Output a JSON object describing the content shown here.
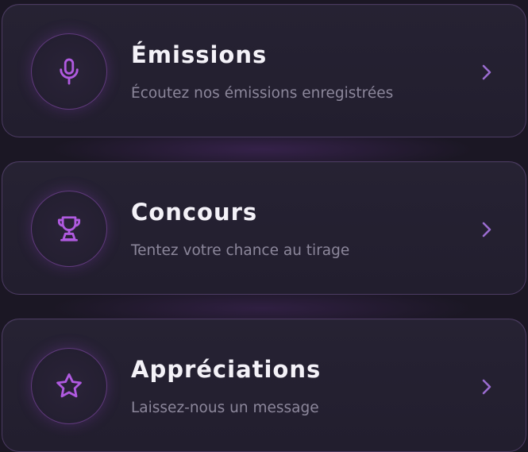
{
  "colors": {
    "accent": "#a855d8",
    "chevron": "#9a6ccf",
    "title": "#f4f2f8",
    "subtitle": "#8c879b",
    "background": "#1b1724",
    "card": "#242031"
  },
  "menu": {
    "items": [
      {
        "icon": "microphone-icon",
        "title": "Émissions",
        "subtitle": "Écoutez nos émissions enregistrées"
      },
      {
        "icon": "trophy-icon",
        "title": "Concours",
        "subtitle": "Tentez votre chance au tirage"
      },
      {
        "icon": "star-icon",
        "title": "Appréciations",
        "subtitle": "Laissez-nous un message"
      }
    ]
  }
}
